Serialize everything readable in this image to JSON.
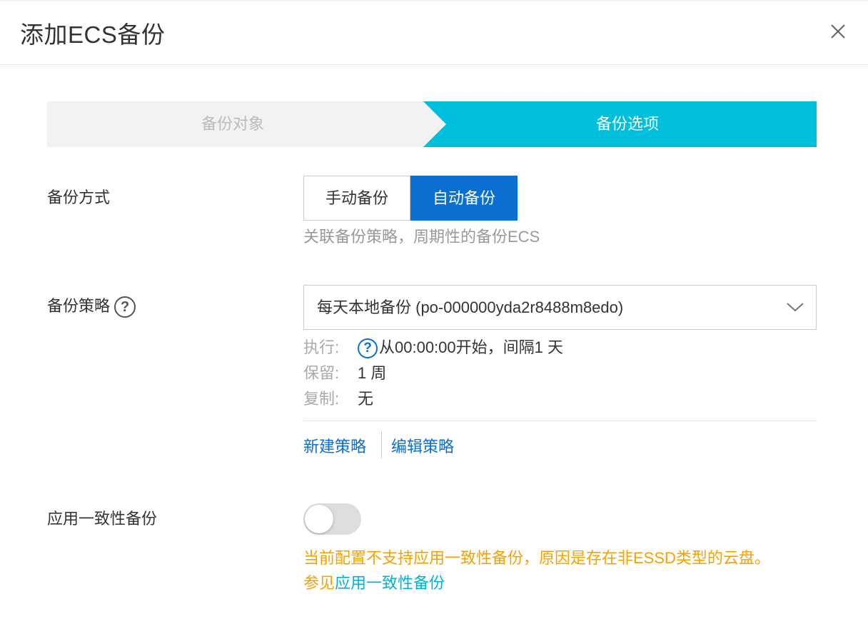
{
  "dialog": {
    "title": "添加ECS备份",
    "close_icon": "close-icon"
  },
  "steps": [
    {
      "label": "备份对象",
      "state": "done"
    },
    {
      "label": "备份选项",
      "state": "active"
    }
  ],
  "colors": {
    "accent": "#0a6fd0",
    "step_active": "#00bfdc",
    "step_inactive": "#f2f2f2",
    "warning": "#f5a200",
    "link_cyan": "#00b3d6"
  },
  "backup_mode": {
    "label": "备份方式",
    "options": [
      "手动备份",
      "自动备份"
    ],
    "selected": "自动备份",
    "hint": "关联备份策略，周期性的备份ECS"
  },
  "policy": {
    "label": "备份策略",
    "help_icon": "question-circle-icon",
    "selected_value": "每天本地备份 (po-000000yda2r8488m8edo)",
    "dropdown_icon": "chevron-down-icon",
    "details": {
      "exec_key": "执行:",
      "exec_value": "从00:00:00开始，间隔1 天",
      "retain_key": "保留:",
      "retain_value": "1 周",
      "copy_key": "复制:",
      "copy_value": "无"
    },
    "new_label": "新建策略",
    "edit_label": "编辑策略"
  },
  "app_consistent": {
    "label": "应用一致性备份",
    "enabled": false,
    "warning": "当前配置不支持应用一致性备份，原因是存在非ESSD类型的云盘。",
    "see_prefix": "参见",
    "see_link": "应用一致性备份"
  }
}
